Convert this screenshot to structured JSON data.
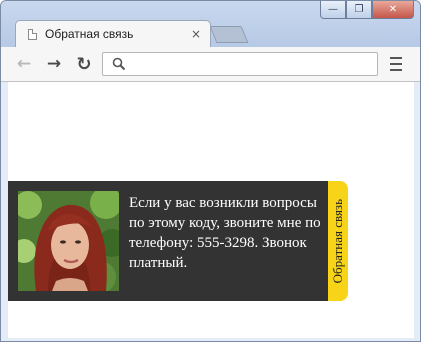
{
  "browser": {
    "tab": {
      "title": "Обратная связь",
      "close_glyph": "×",
      "icon": "page-icon"
    },
    "window_controls": {
      "minimize": "—",
      "maximize": "❐",
      "close": "✕"
    },
    "nav": {
      "back": "←",
      "forward": "→",
      "reload": "↻"
    },
    "omnibox": {
      "value": "",
      "icon": "search-icon"
    },
    "menu_icon": "hamburger-menu-icon"
  },
  "feedback": {
    "text": "Если у вас возникли вопросы по этому коду, звоните мне по телефону: 555-3298. Звонок платный.",
    "tab_label": "Обратная связь",
    "photo_icon": "portrait-photo",
    "colors": {
      "panel": "#333333",
      "tab": "#f7d417",
      "text": "#ffffff"
    }
  }
}
